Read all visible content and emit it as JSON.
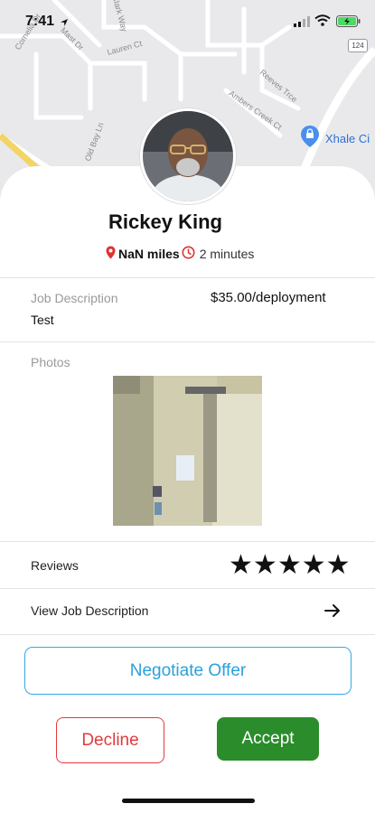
{
  "status_bar": {
    "time": "7:41"
  },
  "map": {
    "streets": [
      "Cornelia Dr",
      "Clark Way",
      "Mast Dr",
      "Lauren Ct",
      "Reeves Trce",
      "Ambers Creek Ct",
      "Old Bay Ln"
    ],
    "highway_shield": "124",
    "poi_label": "Xhale Ci"
  },
  "provider": {
    "name": "Rickey King",
    "distance": "NaN miles",
    "duration": "2 minutes"
  },
  "job": {
    "description_label": "Job Description",
    "price": "$35.00/deployment",
    "description": "Test"
  },
  "photos": {
    "label": "Photos"
  },
  "reviews": {
    "label": "Reviews",
    "rating": 5,
    "max": 5,
    "stars_text": "★★★★★"
  },
  "view_job": {
    "label": "View Job Description"
  },
  "actions": {
    "negotiate_label": "Negotiate Offer",
    "decline_label": "Decline",
    "accept_label": "Accept"
  },
  "colors": {
    "accent_blue": "#34a8e6",
    "decline_red": "#e23b3b",
    "accept_green": "#2b8c2b",
    "pin_red": "#e0322f"
  },
  "icons": [
    "location-arrow-icon",
    "cell-signal-icon",
    "wifi-icon",
    "battery-icon",
    "map-pin-icon",
    "clock-icon",
    "star-icon",
    "arrow-right-icon",
    "poi-pin-icon"
  ]
}
